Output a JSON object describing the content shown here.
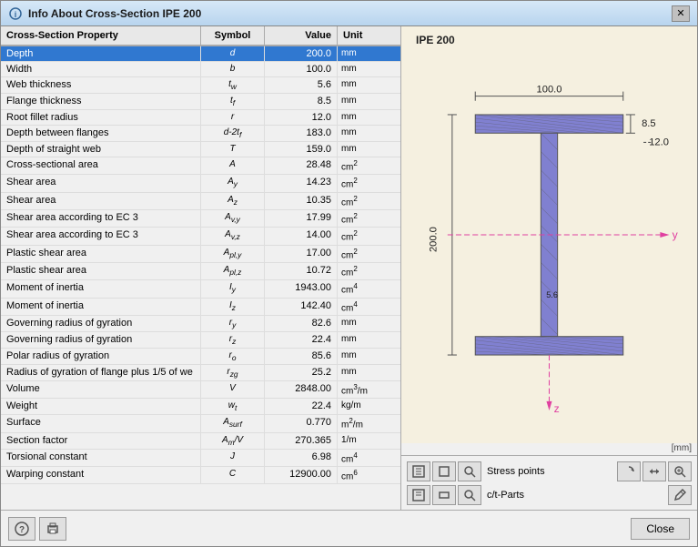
{
  "window": {
    "title": "Info About Cross-Section IPE 200",
    "icon": "ℹ"
  },
  "table": {
    "headers": {
      "property": "Cross-Section Property",
      "symbol": "Symbol",
      "value": "Value",
      "unit": "Unit"
    },
    "rows": [
      {
        "property": "Depth",
        "symbol": "d",
        "value": "200.0",
        "unit": "mm",
        "selected": true
      },
      {
        "property": "Width",
        "symbol": "b",
        "value": "100.0",
        "unit": "mm",
        "selected": false
      },
      {
        "property": "Web thickness",
        "symbol": "tw",
        "value": "5.6",
        "unit": "mm",
        "selected": false
      },
      {
        "property": "Flange thickness",
        "symbol": "tf",
        "value": "8.5",
        "unit": "mm",
        "selected": false
      },
      {
        "property": "Root fillet radius",
        "symbol": "r",
        "value": "12.0",
        "unit": "mm",
        "selected": false
      },
      {
        "property": "Depth between flanges",
        "symbol": "d-2tf",
        "value": "183.0",
        "unit": "mm",
        "selected": false
      },
      {
        "property": "Depth of straight web",
        "symbol": "T",
        "value": "159.0",
        "unit": "mm",
        "selected": false
      },
      {
        "property": "Cross-sectional area",
        "symbol": "A",
        "value": "28.48",
        "unit": "cm²",
        "selected": false
      },
      {
        "property": "Shear area",
        "symbol": "Ay",
        "value": "14.23",
        "unit": "cm²",
        "selected": false
      },
      {
        "property": "Shear area",
        "symbol": "Az",
        "value": "10.35",
        "unit": "cm²",
        "selected": false
      },
      {
        "property": "Shear area according to EC 3",
        "symbol": "Av,y",
        "value": "17.99",
        "unit": "cm²",
        "selected": false
      },
      {
        "property": "Shear area according to EC 3",
        "symbol": "Av,z",
        "value": "14.00",
        "unit": "cm²",
        "selected": false
      },
      {
        "property": "Plastic shear area",
        "symbol": "Apl,y",
        "value": "17.00",
        "unit": "cm²",
        "selected": false
      },
      {
        "property": "Plastic shear area",
        "symbol": "Apl,z",
        "value": "10.72",
        "unit": "cm²",
        "selected": false
      },
      {
        "property": "Moment of inertia",
        "symbol": "Iy",
        "value": "1943.00",
        "unit": "cm⁴",
        "selected": false
      },
      {
        "property": "Moment of inertia",
        "symbol": "Iz",
        "value": "142.40",
        "unit": "cm⁴",
        "selected": false
      },
      {
        "property": "Governing radius of gyration",
        "symbol": "ry",
        "value": "82.6",
        "unit": "mm",
        "selected": false
      },
      {
        "property": "Governing radius of gyration",
        "symbol": "rz",
        "value": "22.4",
        "unit": "mm",
        "selected": false
      },
      {
        "property": "Polar radius of gyration",
        "symbol": "ro",
        "value": "85.6",
        "unit": "mm",
        "selected": false
      },
      {
        "property": "Radius of gyration of flange plus 1/5 of we",
        "symbol": "rzg",
        "value": "25.2",
        "unit": "mm",
        "selected": false
      },
      {
        "property": "Volume",
        "symbol": "V",
        "value": "2848.00",
        "unit": "cm³/m",
        "selected": false
      },
      {
        "property": "Weight",
        "symbol": "wt",
        "value": "22.4",
        "unit": "kg/m",
        "selected": false
      },
      {
        "property": "Surface",
        "symbol": "Asurf",
        "value": "0.770",
        "unit": "m²/m",
        "selected": false
      },
      {
        "property": "Section factor",
        "symbol": "Am/V",
        "value": "270.365",
        "unit": "1/m",
        "selected": false
      },
      {
        "property": "Torsional constant",
        "symbol": "J",
        "value": "6.98",
        "unit": "cm⁴",
        "selected": false
      },
      {
        "property": "Warping constant",
        "symbol": "C",
        "value": "12900.00",
        "unit": "cm⁶",
        "selected": false
      }
    ]
  },
  "drawing": {
    "title": "IPE 200",
    "mm_label": "[mm]",
    "dim_100": "100.0",
    "dim_85": "8.5",
    "dim_12": "12.0",
    "dim_200": "200.0",
    "dim_56": "5.6",
    "axis_y": "y",
    "axis_z": "z"
  },
  "toolbar": {
    "row1": {
      "label": "Stress points",
      "btns_left": [
        "frame-icon",
        "rect-icon",
        "zoom-icon"
      ],
      "btns_right": [
        "rotate-icon",
        "flip-icon",
        "search-icon"
      ]
    },
    "row2": {
      "label": "c/t-Parts",
      "btns_left": [
        "frame2-icon",
        "rect2-icon",
        "zoom2-icon"
      ],
      "btns_right": [
        "edit-icon"
      ]
    }
  },
  "bottom": {
    "close_label": "Close"
  }
}
